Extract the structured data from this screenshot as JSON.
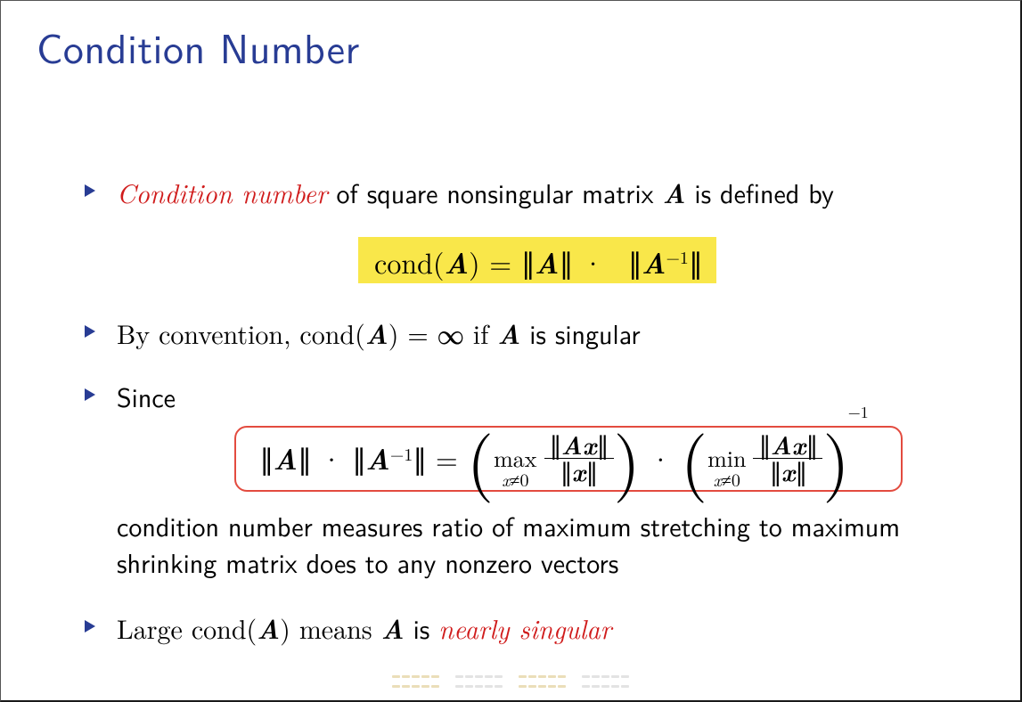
{
  "title": "Condition Number",
  "bullets": {
    "b1_pre_em": "Condition number",
    "b1_post": " of square nonsingular matrix ",
    "b1_matrix": "A",
    "b1_end": " is defined by",
    "b2_pre": "By convention, cond(",
    "b2_matrix": "A",
    "b2_mid": ") = ∞ if ",
    "b2_matrix2": "A",
    "b2_end": " is singular",
    "b3": "Since",
    "b3c_a": "condition number measures ratio of maximum stretching to maximum shrinking matrix does to any nonzero vectors",
    "b4_pre": "Large cond(",
    "b4_matrix": "A",
    "b4_mid": ") means ",
    "b4_matrix2": "A",
    "b4_is": " is ",
    "b4_em": "nearly singular"
  },
  "formula": {
    "cond_lhs_pre": "cond(",
    "cond_lhs_A": "A",
    "cond_lhs_post": ") = ",
    "norm_open": "∥",
    "norm_close": "∥",
    "A": "A",
    "dot": " · ",
    "inv": "−1",
    "eq": " = ",
    "max": "max",
    "min": "min",
    "sub_x_neq_0_x": "x",
    "sub_x_neq_0_neq": "≠",
    "sub_x_neq_0_0": "0",
    "Ax": "Ax",
    "x": "x"
  }
}
